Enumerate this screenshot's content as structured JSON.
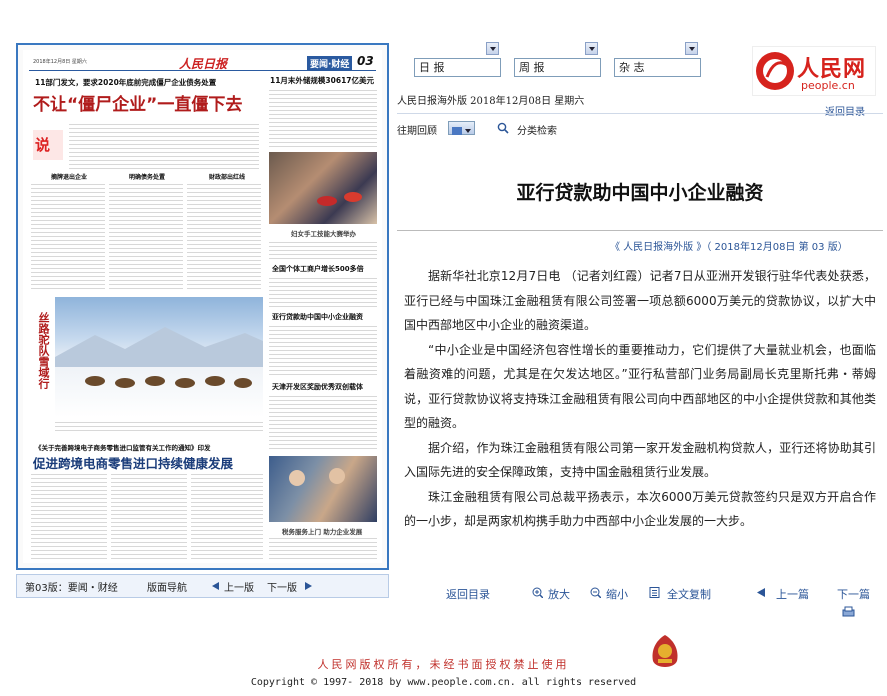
{
  "top_selects": [
    {
      "label": "日 报"
    },
    {
      "label": "周 报"
    },
    {
      "label": "杂 志"
    }
  ],
  "header": {
    "pub_line": "人民日报海外版  2018年12月08日  星期六",
    "back_link": "返回目录",
    "logo_text": "人民网",
    "logo_url_text": "people.cn",
    "past_review": "往期回顾",
    "category_search": "分类检索"
  },
  "paper": {
    "date_small": "2018年12月8日   星期六",
    "masthead": "人民日报",
    "section_tag": "要闻·财经",
    "page_no": "03",
    "lead_kicker": "11部门发文，要求2020年底前完成僵尸企业债务处置",
    "lead_headline": "不让“僵尸企业”一直僵下去",
    "side_headline_1": "11月末外储规模30617亿美元",
    "sub_heads": [
      "摘牌退出企业",
      "明确债务处置",
      "财政部出红线"
    ],
    "caption_1": "妇女手工技能大赛举办",
    "side_headline_2": "全国个体工商户增长500多倍",
    "side_headline_3": "亚行贷款助中国中小企业融资",
    "vertical_title": "丝路驼队雪域行",
    "side_headline_4": "天津开发区奖励优秀双创载体",
    "bottom_kicker": "《关于完善跨境电子商务零售进口监管有关工作的通知》印发",
    "bottom_headline": "促进跨境电商零售进口持续健康发展",
    "caption_2": "税务服务上门  助力企业发展"
  },
  "paper_nav": {
    "page_label": "第03版：要闻・财经",
    "layout_nav": "版面导航",
    "prev": "上一版",
    "next": "下一版"
  },
  "article": {
    "title": "亚行贷款助中国中小企业融资",
    "source_line": "《 人民日报海外版 》（ 2018年12月08日    第 03 版）",
    "paragraphs": [
      "据新华社北京12月7日电  （记者刘红霞）记者7日从亚洲开发银行驻华代表处获悉，亚行已经与中国珠江金融租赁有限公司签署一项总额6000万美元的贷款协议，以扩大中国中西部地区中小企业的融资渠道。",
      "“中小企业是中国经济包容性增长的重要推动力，它们提供了大量就业机会，也面临着融资难的问题，尤其是在欠发达地区。”亚行私营部门业务局副局长克里斯托弗・蒂姆说，亚行贷款协议将支持珠江金融租赁有限公司向中西部地区的中小企提供贷款和其他类型的融资。",
      "据介绍，作为珠江金融租赁有限公司第一家开发金融机构贷款人，亚行还将协助其引入国际先进的安全保障政策，支持中国金融租赁行业发展。",
      "珠江金融租赁有限公司总裁平扬表示，本次6000万美元贷款签约只是双方开启合作的一小步，却是两家机构携手助力中西部中小企业发展的一大步。"
    ]
  },
  "toolbar": {
    "back": "返回目录",
    "zoom_in": "放大",
    "zoom_out": "缩小",
    "copy_all": "全文复制",
    "prev_article": "上一篇",
    "next_article": "下一篇"
  },
  "footer": {
    "rights": "人民网版权所有，未经书面授权禁止使用",
    "copyright": "Copyright © 1997- 2018 by www.people.com.cn. all rights reserved"
  },
  "colors": {
    "frame_blue": "#3a78c0",
    "link_blue": "#2b5597",
    "footer_red": "#c0302b",
    "logo_red": "#d6231d"
  }
}
